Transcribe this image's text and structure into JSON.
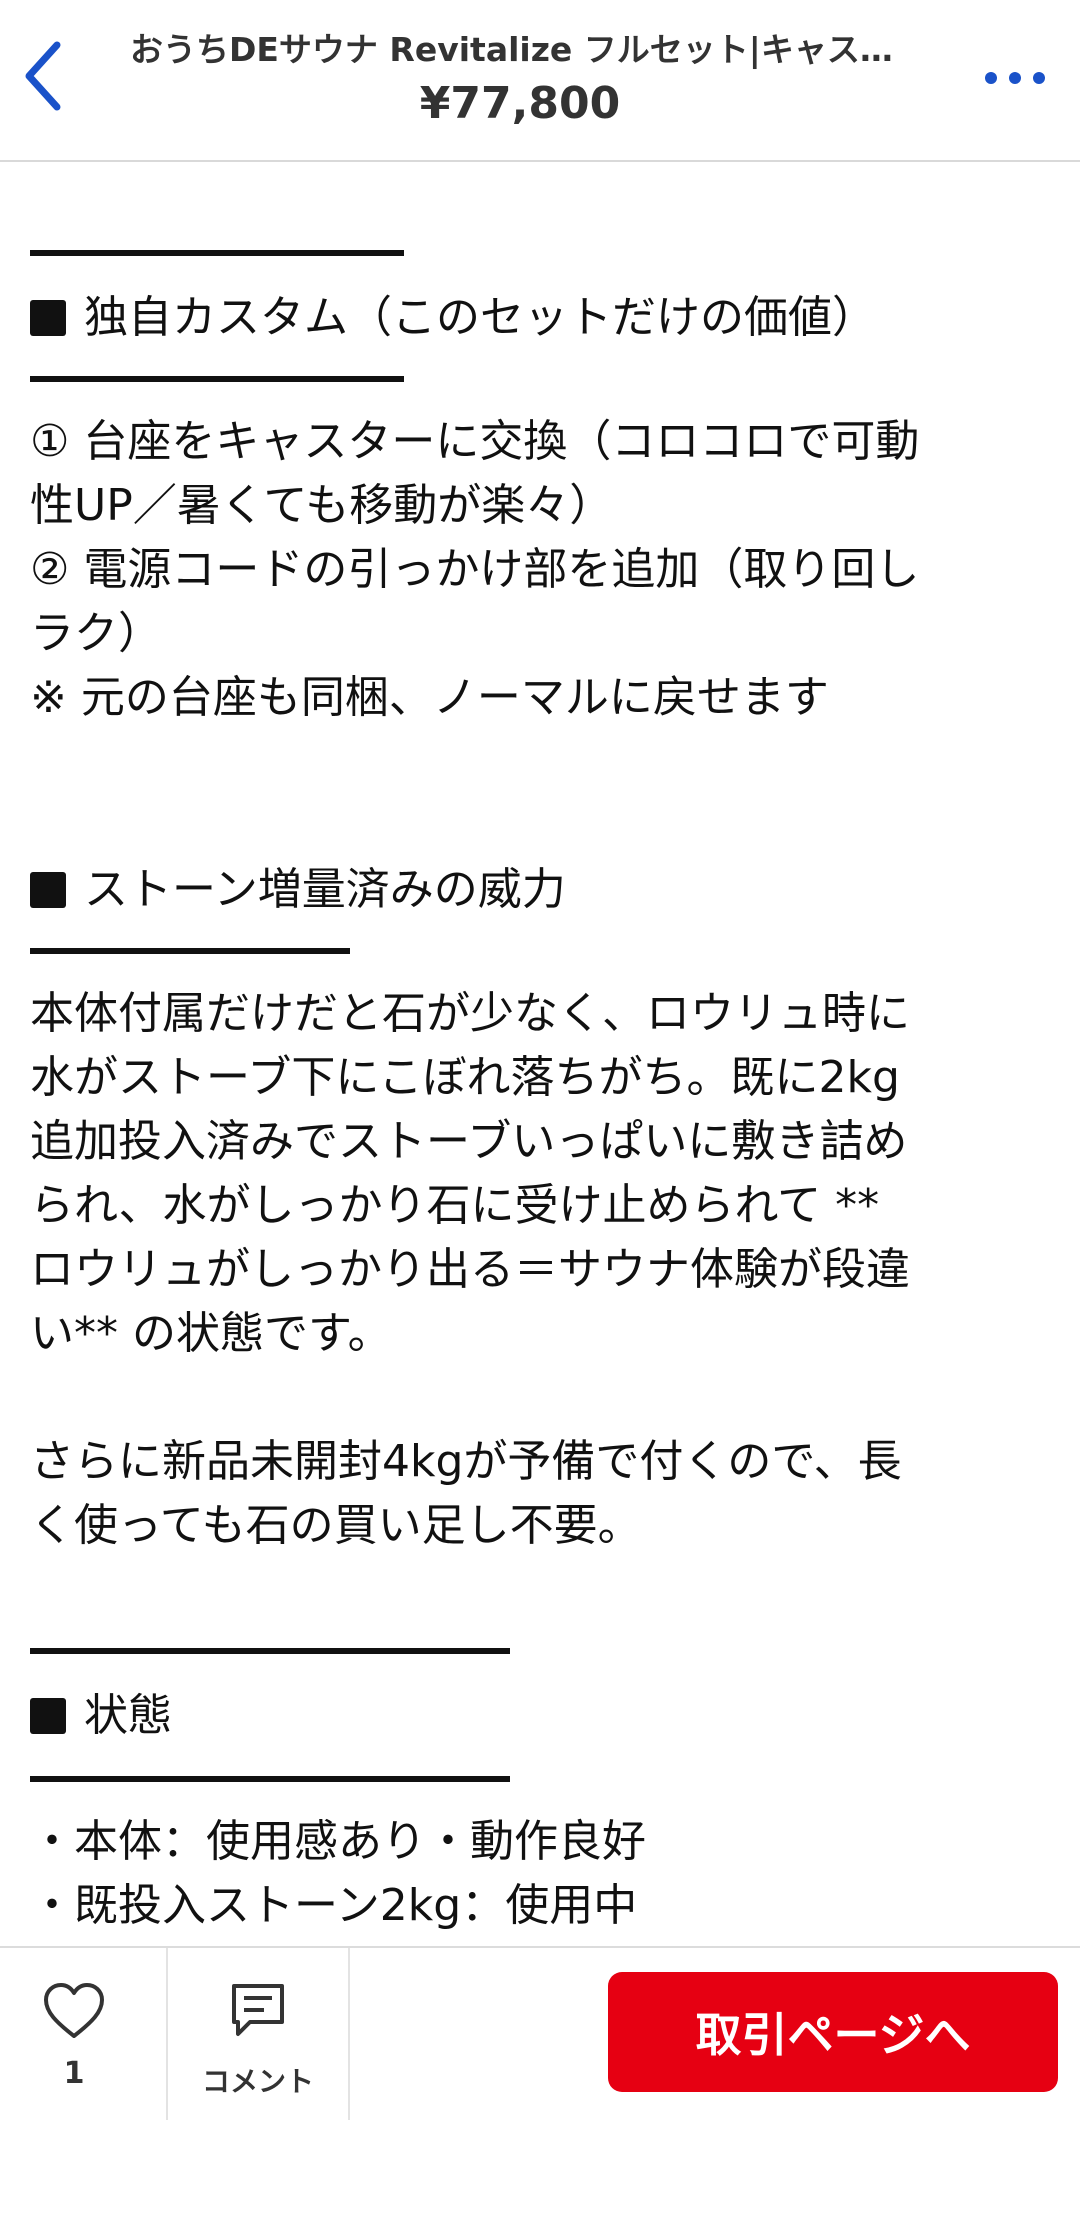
{
  "header": {
    "title": "おうちDEサウナ Revitalize フルセット|キャスターカスタム",
    "price": "¥77,800",
    "back_icon": "chevron-left-icon",
    "more_icon": "more-horizontal-icon",
    "accent_color": "#1a52c9"
  },
  "description": {
    "custom": {
      "heading": "独自カスタム（このセットだけの価値）",
      "lines": [
        "① 台座をキャスターに交換（コロコロで可動",
        "性UP／暑くても移動が楽々）",
        "② 電源コードの引っかけ部を追加（取り回し",
        "ラク）",
        "※ 元の台座も同梱、ノーマルに戻せます"
      ]
    },
    "stone": {
      "heading": "ストーン増量済みの威力",
      "lines": [
        "本体付属だけだと石が少なく、ロウリュ時に",
        "水がストーブ下にこぼれ落ちがち。既に2kg",
        "追加投入済みでストーブいっぱいに敷き詰め",
        "られ、水がしっかり石に受け止められて **",
        "ロウリュがしっかり出る＝サウナ体験が段違",
        "い** の状態です。"
      ],
      "lines2": [
        "さらに新品未開封4kgが予備で付くので、長",
        "く使っても石の買い足し不要。"
      ]
    },
    "condition": {
      "heading": "状態",
      "lines": [
        "・本体：使用感あり・動作良好",
        "・既投入ストーン2kg：使用中"
      ]
    }
  },
  "bottom_bar": {
    "like_count": "1",
    "like_icon": "heart-icon",
    "comment_label": "コメント",
    "comment_icon": "comment-icon",
    "trade_button": "取引ページへ",
    "trade_button_color": "#e60012"
  }
}
